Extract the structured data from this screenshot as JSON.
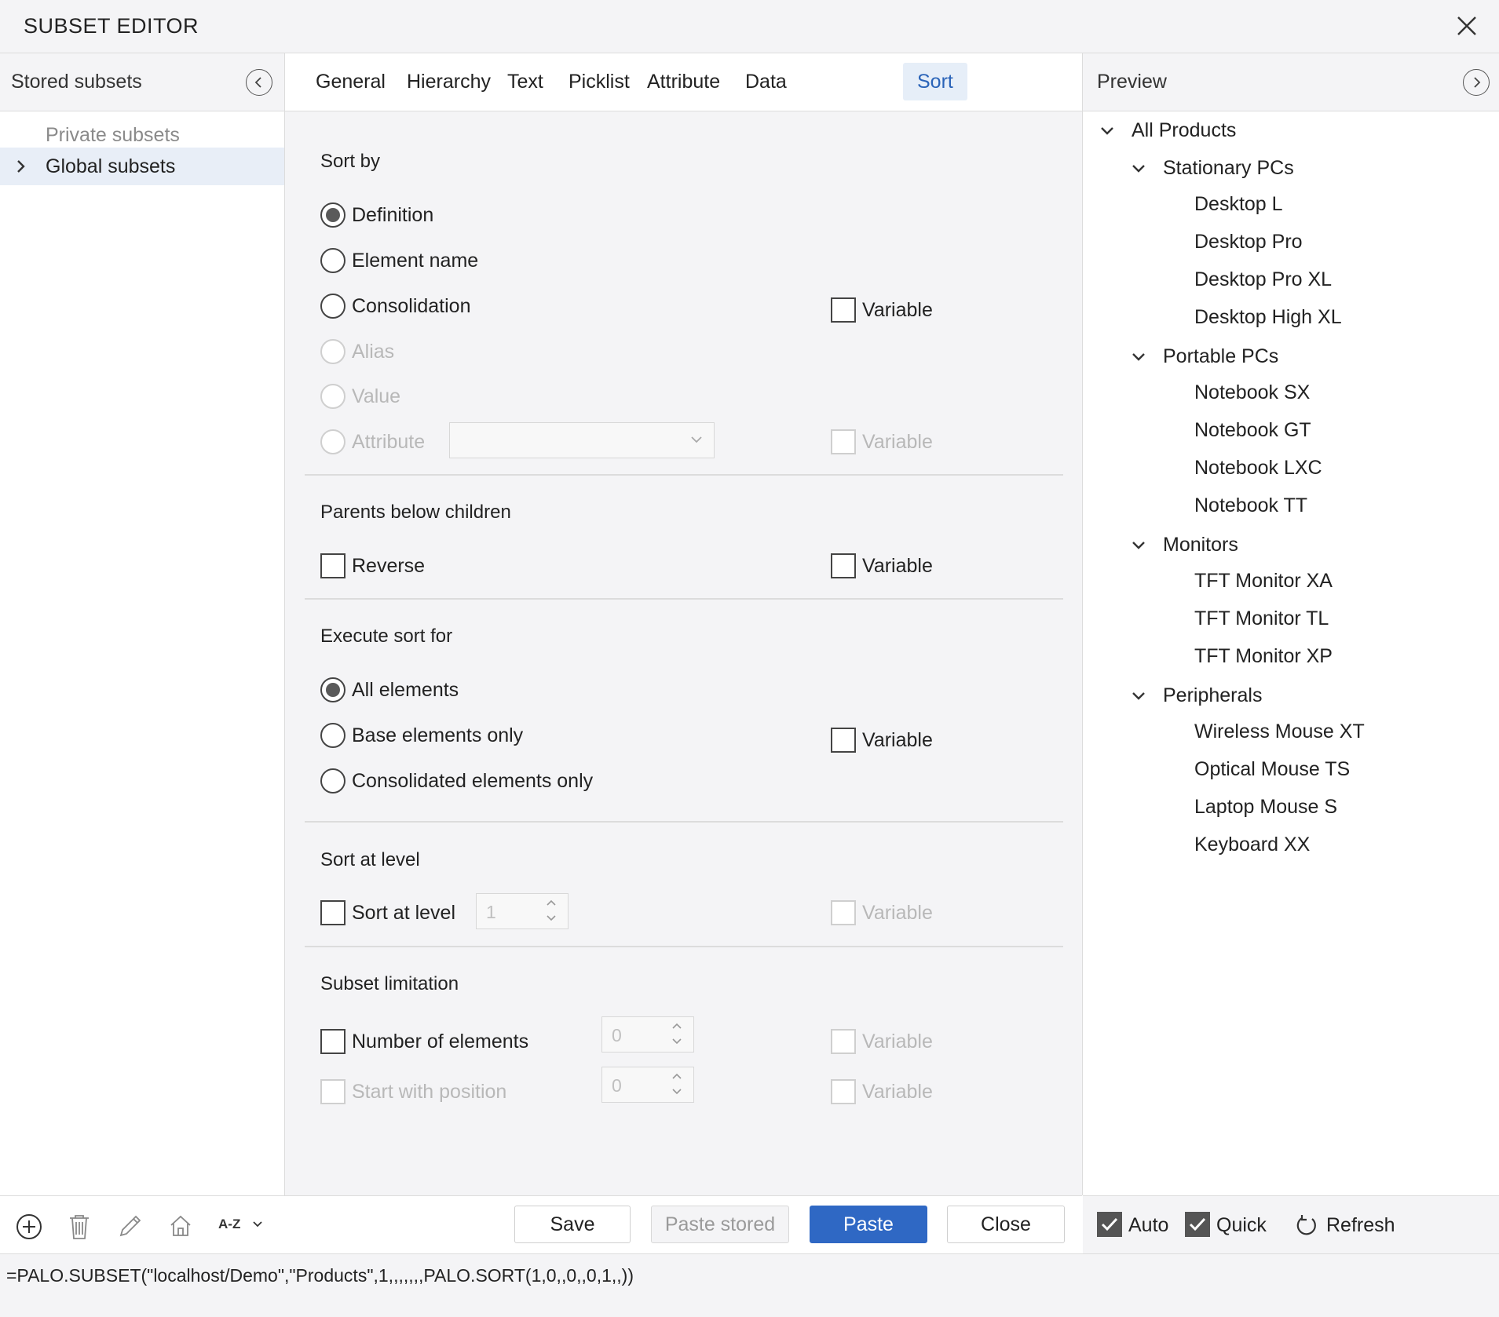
{
  "window": {
    "title": "SUBSET EDITOR"
  },
  "left_pane": {
    "header": "Stored subsets",
    "items": [
      {
        "label": "Private subsets"
      },
      {
        "label": "Global subsets"
      }
    ],
    "toolbar": {
      "sort_label": "A-Z"
    }
  },
  "tabs": [
    "General",
    "Hierarchy",
    "Text",
    "Picklist",
    "Attribute",
    "Data",
    "Sort"
  ],
  "active_tab": "Sort",
  "sort": {
    "sort_by": {
      "title": "Sort by",
      "options": [
        "Definition",
        "Element name",
        "Consolidation",
        "Alias",
        "Value",
        "Attribute"
      ],
      "selected": "Definition",
      "variable_label": "Variable",
      "attribute_value": ""
    },
    "parents_below_children": {
      "title": "Parents below children",
      "reverse_label": "Reverse",
      "variable_label": "Variable"
    },
    "execute_sort_for": {
      "title": "Execute sort for",
      "options": [
        "All elements",
        "Base elements only",
        "Consolidated elements only"
      ],
      "selected": "All elements",
      "variable_label": "Variable"
    },
    "sort_at_level": {
      "title": "Sort at level",
      "checkbox_label": "Sort at level",
      "level_value": "1",
      "variable_label": "Variable"
    },
    "subset_limitation": {
      "title": "Subset limitation",
      "number_label": "Number of elements",
      "number_value": "0",
      "start_label": "Start with position",
      "start_value": "0",
      "variable_label": "Variable"
    }
  },
  "footer": {
    "save": "Save",
    "paste_stored": "Paste stored",
    "paste": "Paste",
    "close": "Close"
  },
  "preview": {
    "header": "Preview",
    "tree": [
      {
        "label": "All Products",
        "expanded": true,
        "children": [
          {
            "label": "Stationary PCs",
            "expanded": true,
            "children": [
              "Desktop L",
              "Desktop Pro",
              "Desktop Pro XL",
              "Desktop High XL"
            ]
          },
          {
            "label": "Portable PCs",
            "expanded": true,
            "children": [
              "Notebook SX",
              "Notebook GT",
              "Notebook LXC",
              "Notebook TT"
            ]
          },
          {
            "label": "Monitors",
            "expanded": true,
            "children": [
              "TFT Monitor XA",
              "TFT Monitor TL",
              "TFT Monitor XP"
            ]
          },
          {
            "label": "Peripherals",
            "expanded": true,
            "children": [
              "Wireless Mouse XT",
              "Optical Mouse TS",
              "Laptop Mouse S",
              "Keyboard XX"
            ]
          }
        ]
      }
    ],
    "auto_label": "Auto",
    "auto_checked": true,
    "quick_label": "Quick",
    "quick_checked": true,
    "refresh_label": "Refresh"
  },
  "formula": "=PALO.SUBSET(\"localhost/Demo\",\"Products\",1,,,,,,,PALO.SORT(1,0,,0,,0,1,,))",
  "colors": {
    "accent": "#2f68c4",
    "active_tab_bg": "#e6eef8",
    "panel_bg": "#f4f4f6"
  }
}
